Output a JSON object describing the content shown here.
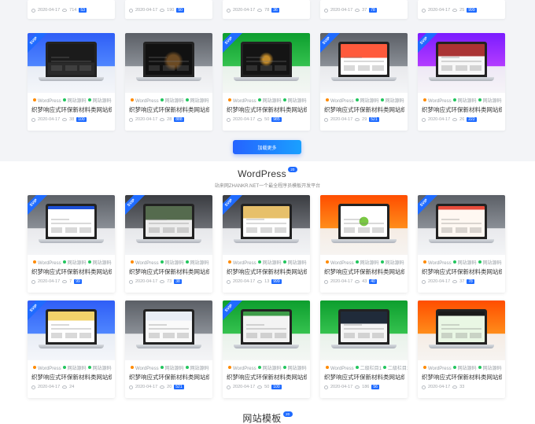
{
  "cards_top_partial": [
    {
      "date": "2020-04-17",
      "views": "714",
      "count": "53"
    },
    {
      "date": "2020-04-17",
      "views": "190",
      "count": "50"
    },
    {
      "date": "2020-04-17",
      "views": "78",
      "count": "36"
    },
    {
      "date": "2020-04-17",
      "views": "37",
      "count": "78"
    },
    {
      "date": "2020-04-17",
      "views": "25",
      "count": "999"
    }
  ],
  "cards_top": [
    {
      "vip": "SVIP",
      "tag1": "WordPress",
      "tag2": "网站源码",
      "tag3": "网站源码",
      "title": "织梦响应式环保新材料类网站织...",
      "date": "2020-04-17",
      "views": "38",
      "count": "100",
      "theme": "blue"
    },
    {
      "vip": "",
      "tag1": "WordPress",
      "tag2": "网站源码",
      "tag3": "网站源码",
      "title": "织梦响应式环保新材料类网站织...",
      "date": "2020-04-17",
      "views": "28",
      "count": "888",
      "theme": "gray"
    },
    {
      "vip": "SVIP",
      "tag1": "WordPress",
      "tag2": "网站源码",
      "tag3": "网站源码",
      "title": "织梦响应式环保新材料类网站织...",
      "date": "2020-04-17",
      "views": "50",
      "count": "985",
      "theme": "green"
    },
    {
      "vip": "SVIP",
      "tag1": "WordPress",
      "tag2": "网站源码",
      "tag3": "网站源码",
      "title": "织梦响应式环保新材料类网站织...",
      "date": "2020-04-17",
      "views": "29",
      "count": "521",
      "theme": "gray"
    },
    {
      "vip": "SVIP",
      "tag1": "WordPress",
      "tag2": "网站源码",
      "tag3": "网站源码",
      "title": "织梦响应式环保新材料类网站织...",
      "date": "2020-04-17",
      "views": "26",
      "count": "222",
      "theme": "purple"
    }
  ],
  "load_more_label": "加载更多",
  "wordpress_section": {
    "title": "WordPress",
    "badge": "20",
    "subtitle": "站来网ZHANKR.NET一个最全程序员模板开发平台"
  },
  "cards_wp_row1": [
    {
      "vip": "SVIP",
      "tag1": "WordPress",
      "tag2": "网站源码",
      "tag3": "网站源码",
      "title": "织梦响应式环保新材料类网站织...",
      "date": "2020-04-17",
      "views": "7",
      "count": "99",
      "theme": "gray"
    },
    {
      "vip": "SVIP",
      "tag1": "WordPress",
      "tag2": "网站源码",
      "tag3": "网站源码",
      "title": "织梦响应式环保新材料类网站织...",
      "date": "2020-04-17",
      "views": "73",
      "count": "38",
      "theme": "dark"
    },
    {
      "vip": "SVIP",
      "tag1": "WordPress",
      "tag2": "网站源码",
      "tag3": "网站源码",
      "title": "织梦响应式环保新材料类网站织...",
      "date": "2020-04-17",
      "views": "13",
      "count": "999",
      "theme": "dark"
    },
    {
      "vip": "",
      "tag1": "WordPress",
      "tag2": "网站源码",
      "tag3": "网站源码",
      "title": "织梦响应式环保新材料类网站织...",
      "date": "2020-04-17",
      "views": "43",
      "count": "40",
      "theme": "orange"
    },
    {
      "vip": "SVIP",
      "tag1": "WordPress",
      "tag2": "网站源码",
      "tag3": "网站源码",
      "title": "织梦响应式环保新材料类网站织...",
      "date": "2020-04-17",
      "views": "37",
      "count": "78",
      "theme": "gray"
    }
  ],
  "cards_wp_row2": [
    {
      "vip": "SVIP",
      "tag1": "WordPress",
      "tag2": "网站源码",
      "tag3": "网站源码",
      "title": "织梦响应式环保新材料类网站织...",
      "date": "2020-04-17",
      "views": "24",
      "count": "",
      "theme": "blue"
    },
    {
      "vip": "",
      "tag1": "WordPress",
      "tag2": "网站源码",
      "tag3": "网站源码",
      "title": "织梦响应式环保新材料类网站织...",
      "date": "2020-04-17",
      "views": "20",
      "count": "521",
      "theme": "gray"
    },
    {
      "vip": "SVIP",
      "tag1": "WordPress",
      "tag2": "网站源码",
      "tag3": "网站源码",
      "title": "织梦响应式环保新材料类网站织...",
      "date": "2020-04-17",
      "views": "50",
      "count": "100",
      "theme": "green"
    },
    {
      "vip": "",
      "tag1": "WordPress",
      "tag2": "二级栏目1",
      "tag3": "二级栏目1",
      "title": "织梦响应式环保新材料类网站织...",
      "date": "2020-04-17",
      "views": "186",
      "count": "56",
      "theme": "green"
    },
    {
      "vip": "",
      "tag1": "WordPress",
      "tag2": "网站源码",
      "tag3": "网站源码",
      "title": "织梦响应式环保新材料类网站织...",
      "date": "2020-04-17",
      "views": "33",
      "count": "",
      "theme": "orange"
    }
  ],
  "templates_section": {
    "title": "网站模板",
    "badge": "20"
  }
}
